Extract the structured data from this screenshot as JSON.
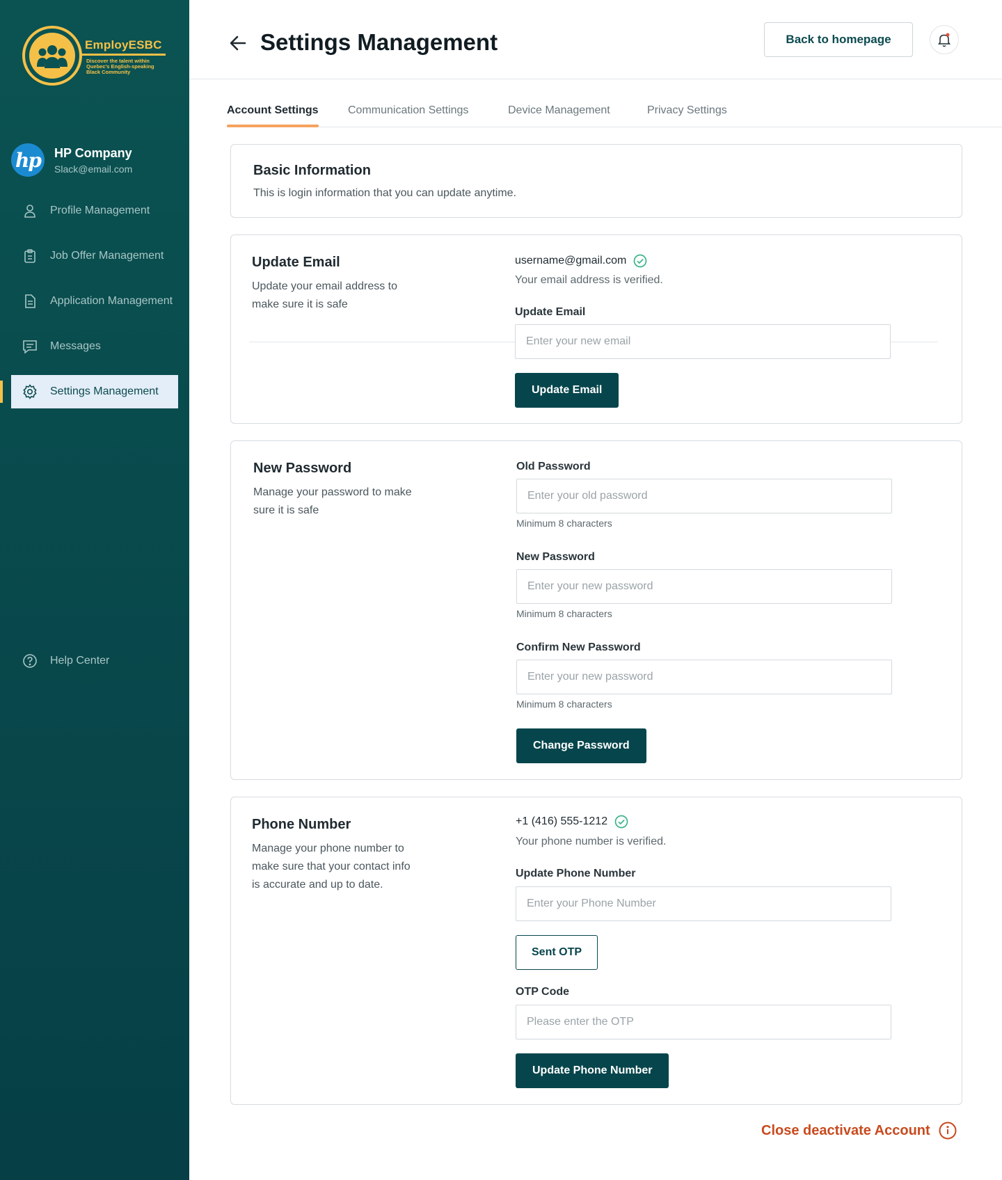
{
  "brand": {
    "name": "EmployESBC",
    "tagline_lines": [
      "Discover the talent within",
      "Quebec's English-speaking",
      "Black Community"
    ],
    "accent": "#f5c047",
    "primary": "#06454c"
  },
  "company": {
    "name": "HP Company",
    "email": "Slack@email.com",
    "logo_text": "hp"
  },
  "sidebar": {
    "items": [
      {
        "label": "Profile Management",
        "icon": "user-icon"
      },
      {
        "label": "Job Offer Management",
        "icon": "clipboard-icon"
      },
      {
        "label": "Application Management",
        "icon": "document-icon"
      },
      {
        "label": "Messages",
        "icon": "message-icon"
      },
      {
        "label": "Settings Management",
        "icon": "gear-icon",
        "active": true
      }
    ],
    "help": {
      "label": "Help Center",
      "icon": "question-icon"
    }
  },
  "header": {
    "title": "Settings Management",
    "back_home_label": "Back to homepage"
  },
  "tabs": [
    {
      "label": "Account Settings",
      "active": true
    },
    {
      "label": "Communication Settings"
    },
    {
      "label": "Device Management"
    },
    {
      "label": "Privacy Settings"
    }
  ],
  "basic": {
    "title": "Basic Information",
    "desc": "This is login information that you can update anytime."
  },
  "email": {
    "title": "Update Email",
    "desc_lines": [
      "Update your email address to",
      "make sure it is safe"
    ],
    "current": "username@gmail.com",
    "verified_note": "Your email address is verified.",
    "field_label": "Update Email",
    "placeholder": "Enter your new email",
    "button": "Update Email"
  },
  "password": {
    "title": "New Password",
    "desc_lines": [
      "Manage your password to make",
      "sure it is safe"
    ],
    "old_label": "Old Password",
    "old_placeholder": "Enter your old password",
    "new_label": "New Password",
    "new_placeholder": "Enter your new password",
    "confirm_label": "Confirm New Password",
    "confirm_placeholder": "Enter your new password",
    "hint": "Minimum 8 characters",
    "button": "Change Password"
  },
  "phone": {
    "title": "Phone Number",
    "desc_lines": [
      "Manage your phone number  to",
      "make sure that your contact info",
      "is accurate and up to date."
    ],
    "current": "+1 (416) 555-1212",
    "verified_note": "Your phone number is verified.",
    "field_label": "Update Phone Number",
    "placeholder": "Enter your Phone Number",
    "otp_button": "Sent OTP",
    "otp_label": "OTP Code",
    "otp_placeholder": "Please enter the OTP",
    "button": "Update Phone Number"
  },
  "deactivate": {
    "label": "Close deactivate Account",
    "color": "#c84a1e"
  }
}
